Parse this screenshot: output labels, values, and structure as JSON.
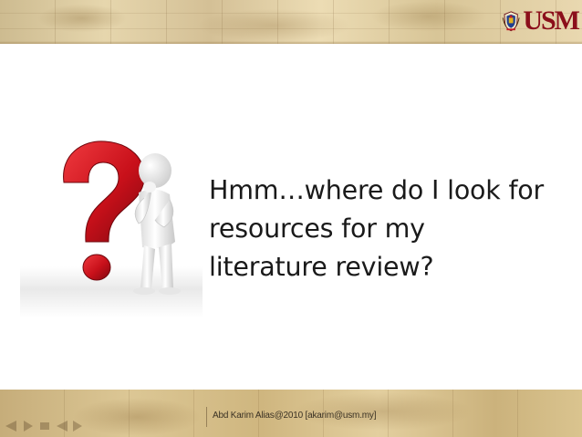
{
  "slide": {
    "headline_lines": [
      "Hmm…where do I look for",
      "resources for my",
      "literature review?"
    ],
    "footer": "Abd Karim Alias@2010 [akarim@usm.my]"
  },
  "logo": {
    "text": "USM",
    "accent_color": "#8b0f1b"
  },
  "illustration": {
    "icon": "question-mark-thinking-figure-icon",
    "question_color": "#d0121b",
    "figure_color": "#f2f2f2"
  }
}
